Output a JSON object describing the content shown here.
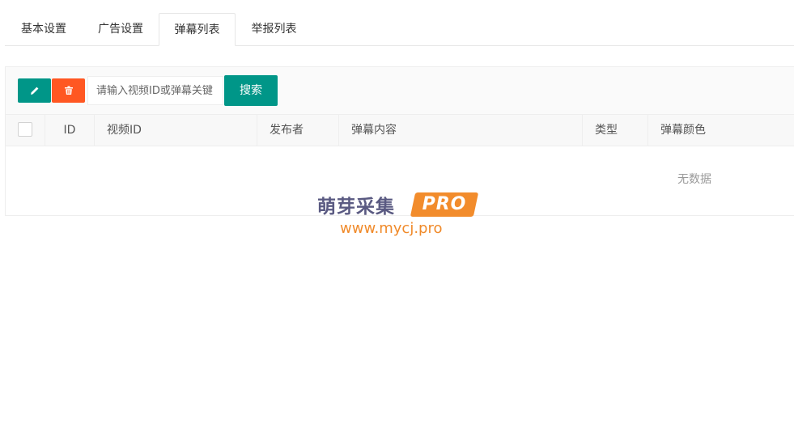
{
  "tabs": [
    {
      "label": "基本设置",
      "active": false
    },
    {
      "label": "广告设置",
      "active": false
    },
    {
      "label": "弹幕列表",
      "active": true
    },
    {
      "label": "举报列表",
      "active": false
    }
  ],
  "toolbar": {
    "edit_icon": "pencil-icon",
    "delete_icon": "trash-icon",
    "search_placeholder": "请输入视频ID或弹幕关键",
    "search_value": "",
    "search_label": "搜索"
  },
  "table": {
    "columns": [
      "ID",
      "视频ID",
      "发布者",
      "弹幕内容",
      "类型",
      "弹幕颜色"
    ],
    "empty_text": "无数据"
  },
  "watermark": {
    "name": "萌芽采集",
    "badge": "PRO",
    "url": "www.mycj.pro"
  },
  "colors": {
    "primary": "#009688",
    "danger": "#ff5722",
    "watermark_orange": "#f28c2c",
    "watermark_text": "#5a5a82"
  }
}
